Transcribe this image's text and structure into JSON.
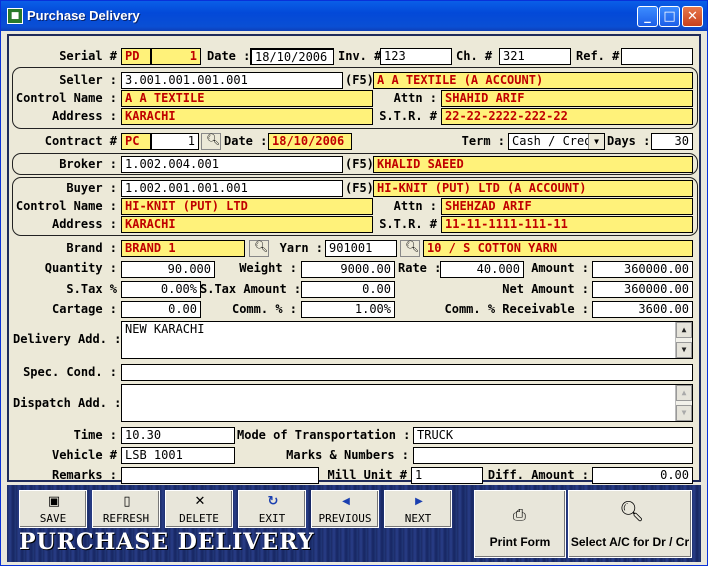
{
  "window": {
    "title": "Purchase Delivery"
  },
  "header": {
    "serial_label": "Serial #",
    "serial_prefix": "PD",
    "serial_no": "1",
    "date_label": "Date :",
    "date": "18/10/2006",
    "inv_label": "Inv. #",
    "inv": "123",
    "ch_label": "Ch. #",
    "ch": "321",
    "ref_label": "Ref. #",
    "ref": ""
  },
  "seller": {
    "label": "Seller :",
    "code": "3.001.001.001.001",
    "f5": "(F5)",
    "name": "A A TEXTILE (A ACCOUNT)",
    "control_label": "Control Name :",
    "control": "A A TEXTILE",
    "attn_label": "Attn :",
    "attn": "SHAHID ARIF",
    "address_label": "Address :",
    "address": "KARACHI",
    "str_label": "S.T.R. #",
    "str": "22-22-2222-222-22"
  },
  "contract": {
    "label": "Contract #",
    "prefix": "PC",
    "no": "1",
    "date_label": "Date :",
    "date": "18/10/2006",
    "term_label": "Term :",
    "term": "Cash / Cred",
    "days_label": "Days :",
    "days": "30"
  },
  "broker": {
    "label": "Broker :",
    "code": "1.002.004.001",
    "f5": "(F5)",
    "name": "KHALID SAEED"
  },
  "buyer": {
    "label": "Buyer :",
    "code": "1.002.001.001.001",
    "f5": "(F5)",
    "name": "HI-KNIT (PUT) LTD (A ACCOUNT)",
    "control_label": "Control Name :",
    "control": "HI-KNIT (PUT) LTD",
    "attn_label": "Attn :",
    "attn": "SHEHZAD ARIF",
    "address_label": "Address :",
    "address": "KARACHI",
    "str_label": "S.T.R. #",
    "str": "11-11-1111-111-11"
  },
  "item": {
    "brand_label": "Brand :",
    "brand": "BRAND 1",
    "yarn_label": "Yarn :",
    "yarn_code": "901001",
    "yarn_name": "10 / S COTTON YARN",
    "quantity_label": "Quantity :",
    "quantity": "90.000",
    "weight_label": "Weight :",
    "weight": "9000.00",
    "rate_label": "Rate :",
    "rate": "40.000",
    "amount_label": "Amount :",
    "amount": "360000.00",
    "stax_pct_label": "S.Tax %",
    "stax_pct": "0.00%",
    "stax_amount_label": "S.Tax Amount :",
    "stax_amount": "0.00",
    "net_amount_label": "Net Amount :",
    "net_amount": "360000.00",
    "cartage_label": "Cartage :",
    "cartage": "0.00",
    "comm_pct_label": "Comm. % :",
    "comm_pct": "1.00%",
    "comm_recv_label": "Comm. % Receivable :",
    "comm_recv": "3600.00"
  },
  "delivery": {
    "delivery_add_label": "Delivery Add. :",
    "delivery_add": "NEW KARACHI",
    "spec_cond_label": "Spec. Cond. :",
    "spec_cond": "",
    "dispatch_add_label": "Dispatch Add. :",
    "dispatch_add": "",
    "time_label": "Time :",
    "time": "10.30",
    "transport_label": "Mode of Transportation :",
    "transport": "TRUCK",
    "vehicle_label": "Vehicle #",
    "vehicle": "LSB 1001",
    "marks_label": "Marks & Numbers :",
    "marks": "",
    "remarks_label": "Remarks :",
    "remarks": "",
    "mill_unit_label": "Mill Unit #",
    "mill_unit": "1",
    "diff_amount_label": "Diff. Amount :",
    "diff_amount": "0.00"
  },
  "toolbar": {
    "save": "SAVE",
    "refresh": "REFRESH",
    "delete": "DELETE",
    "exit": "EXIT",
    "previous": "PREVIOUS",
    "next": "NEXT",
    "print_form": "Print Form",
    "select_ac": "Select A/C for Dr / Cr",
    "brand_text": "PURCHASE DELIVERY"
  }
}
